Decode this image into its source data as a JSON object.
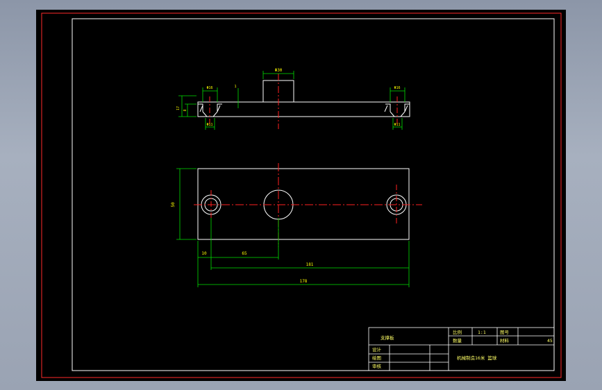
{
  "drawing": {
    "colors": {
      "background": "#000000",
      "outer_border": "#ff2a2a",
      "geometry": "#ffffff",
      "centerline": "#ff2020",
      "dimension": "#00e000",
      "dimension_text": "#ffff00",
      "title_block_text": "#ffff66"
    },
    "top_view": {
      "dims": {
        "boss_width": "Φ30",
        "left_hole_top": "Φ16",
        "left_hole_bottom": "Φ11",
        "right_hole_top": "Φ16",
        "right_hole_bottom": "Φ11",
        "small_offset": "1",
        "height_total": "17",
        "height_counterbore": "8"
      }
    },
    "plan_view": {
      "dims": {
        "height": "50",
        "offset_small": "10",
        "offset_center": "65",
        "hole_span": "181",
        "total_length": "178"
      }
    },
    "title_block": {
      "part_name": "支撑板",
      "scale_label": "比例",
      "scale_value": "1:1",
      "qty_label": "数量",
      "drawing_no_label": "图号",
      "material_label": "材料",
      "material_value": "45",
      "designer_label": "设计",
      "drafter_label": "绘图",
      "checker_label": "审核",
      "school_label": "机械制造16米 篮球"
    }
  }
}
